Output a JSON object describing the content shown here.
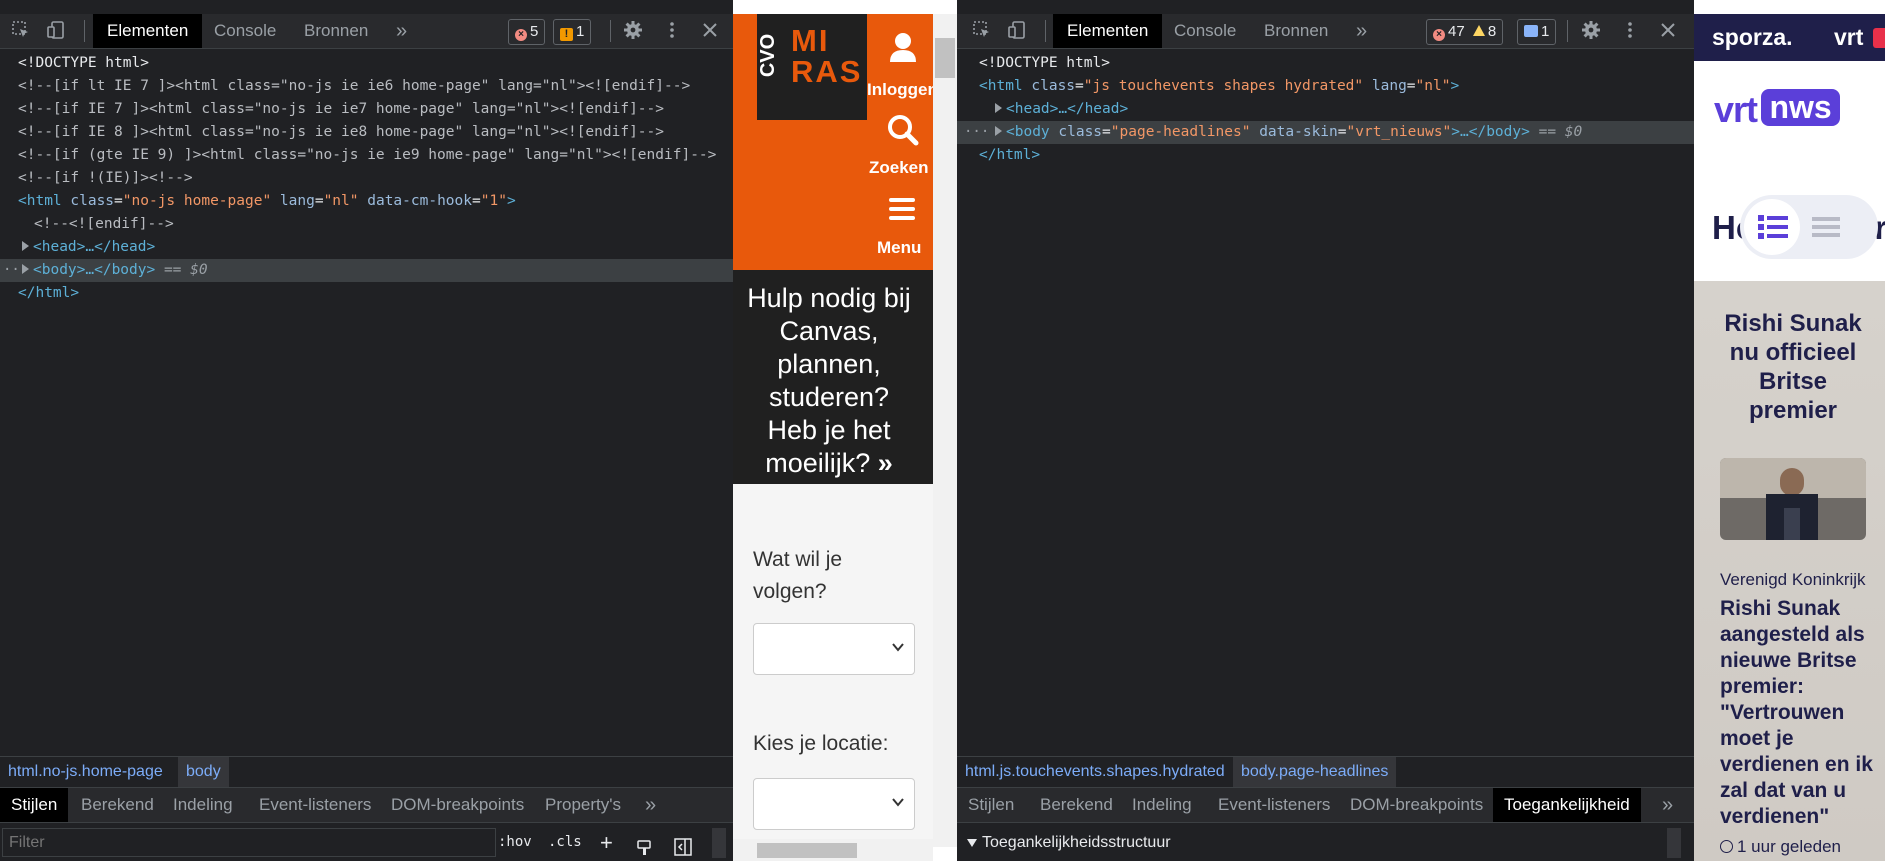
{
  "left_devtools": {
    "tabs": [
      "Elementen",
      "Console",
      "Bronnen"
    ],
    "more_tabs": "»",
    "error_count": "5",
    "warning_count": "1",
    "code_lines": [
      {
        "text": "<!DOCTYPE html>"
      },
      {
        "text": "<!--[if lt IE 7 ]><html class=\"no-js ie ie6 home-page\" lang=\"nl\"><![endif]-->"
      },
      {
        "text": "<!--[if IE 7 ]><html class=\"no-js ie ie7 home-page\" lang=\"nl\"><![endif]-->"
      },
      {
        "text": "<!--[if IE 8 ]><html class=\"no-js ie ie8 home-page\" lang=\"nl\"><![endif]-->"
      },
      {
        "text": "<!--[if (gte IE 9) ]><html class=\"no-js ie ie9 home-page\" lang=\"nl\"><![endif]-->"
      },
      {
        "text": "<!--[if !(IE)]><!-->"
      }
    ],
    "html_open": {
      "tag": "html",
      "class_attr": "class",
      "class_val": "\"no-js home-page\"",
      "lang_attr": "lang",
      "lang_val": "\"nl\"",
      "hook_attr": "data-cm-hook",
      "hook_val": "\"1\""
    },
    "endif_comment": "<!--<![endif]-->",
    "head_node": "<head>…</head>",
    "body_node": "<body>…</body>",
    "selected_marker": "== $0",
    "html_close": "</html>",
    "crumbs": [
      "html.no-js.home-page",
      "body"
    ],
    "bottom_tabs": [
      "Stijlen",
      "Berekend",
      "Indeling",
      "Event-listeners",
      "DOM-breakpoints",
      "Property's"
    ],
    "filter_placeholder": "Filter",
    "hov": ":hov",
    "cls": ".cls"
  },
  "miras_page": {
    "logo_cvo": "CVO",
    "logo_mi": "MI",
    "logo_ras": "RAS",
    "login_label": "Inloggen",
    "search_label": "Zoeken",
    "menu_label": "Menu",
    "help_text": "Hulp nodig bij Canvas, plannen, studeren? Heb je het moeilijk?",
    "follow_label": "Wat wil je volgen?",
    "location_label": "Kies je locatie:",
    "accent_color": "#e8590c"
  },
  "right_devtools": {
    "tabs": [
      "Elementen",
      "Console",
      "Bronnen"
    ],
    "more_tabs": "»",
    "error_count": "47",
    "warning_count": "8",
    "message_count": "1",
    "doctype": "<!DOCTYPE html>",
    "html_open": {
      "tag": "html",
      "class_attr": "class",
      "class_val": "\"js touchevents shapes hydrated\"",
      "lang_attr": "lang",
      "lang_val": "\"nl\""
    },
    "head_node": "<head>…</head>",
    "body_open": {
      "tag": "body",
      "class_attr": "class",
      "class_val": "\"page-headlines\"",
      "skin_attr": "data-skin",
      "skin_val": "\"vrt_nieuws\"",
      "rest": ">…</body>"
    },
    "selected_marker": "== $0",
    "html_close": "</html>",
    "crumbs": [
      "html.js.touchevents.shapes.hydrated",
      "body.page-headlines"
    ],
    "bottom_tabs": [
      "Stijlen",
      "Berekend",
      "Indeling",
      "Event-listeners",
      "DOM-breakpoints",
      "Toegankelijkheid"
    ],
    "accessibility_tree_label": "Toegankelijkheidsstructuur"
  },
  "vrt_page": {
    "sporza": "sporza.",
    "vrt_brand": "vrt",
    "nws_brand": "nws",
    "heading_start": "Ho",
    "heading_end": "er",
    "promo_title": "Rishi Sunak nu officieel Britse premier",
    "category": "Verenigd Koninkrijk",
    "headline": "Rishi Sunak aangesteld als nieuwe Britse premier: \"Vertrouwen moet je verdienen en ik zal dat van u verdienen\"",
    "time_ago": "1 uur geleden",
    "brand_color": "#5b3fd9"
  }
}
